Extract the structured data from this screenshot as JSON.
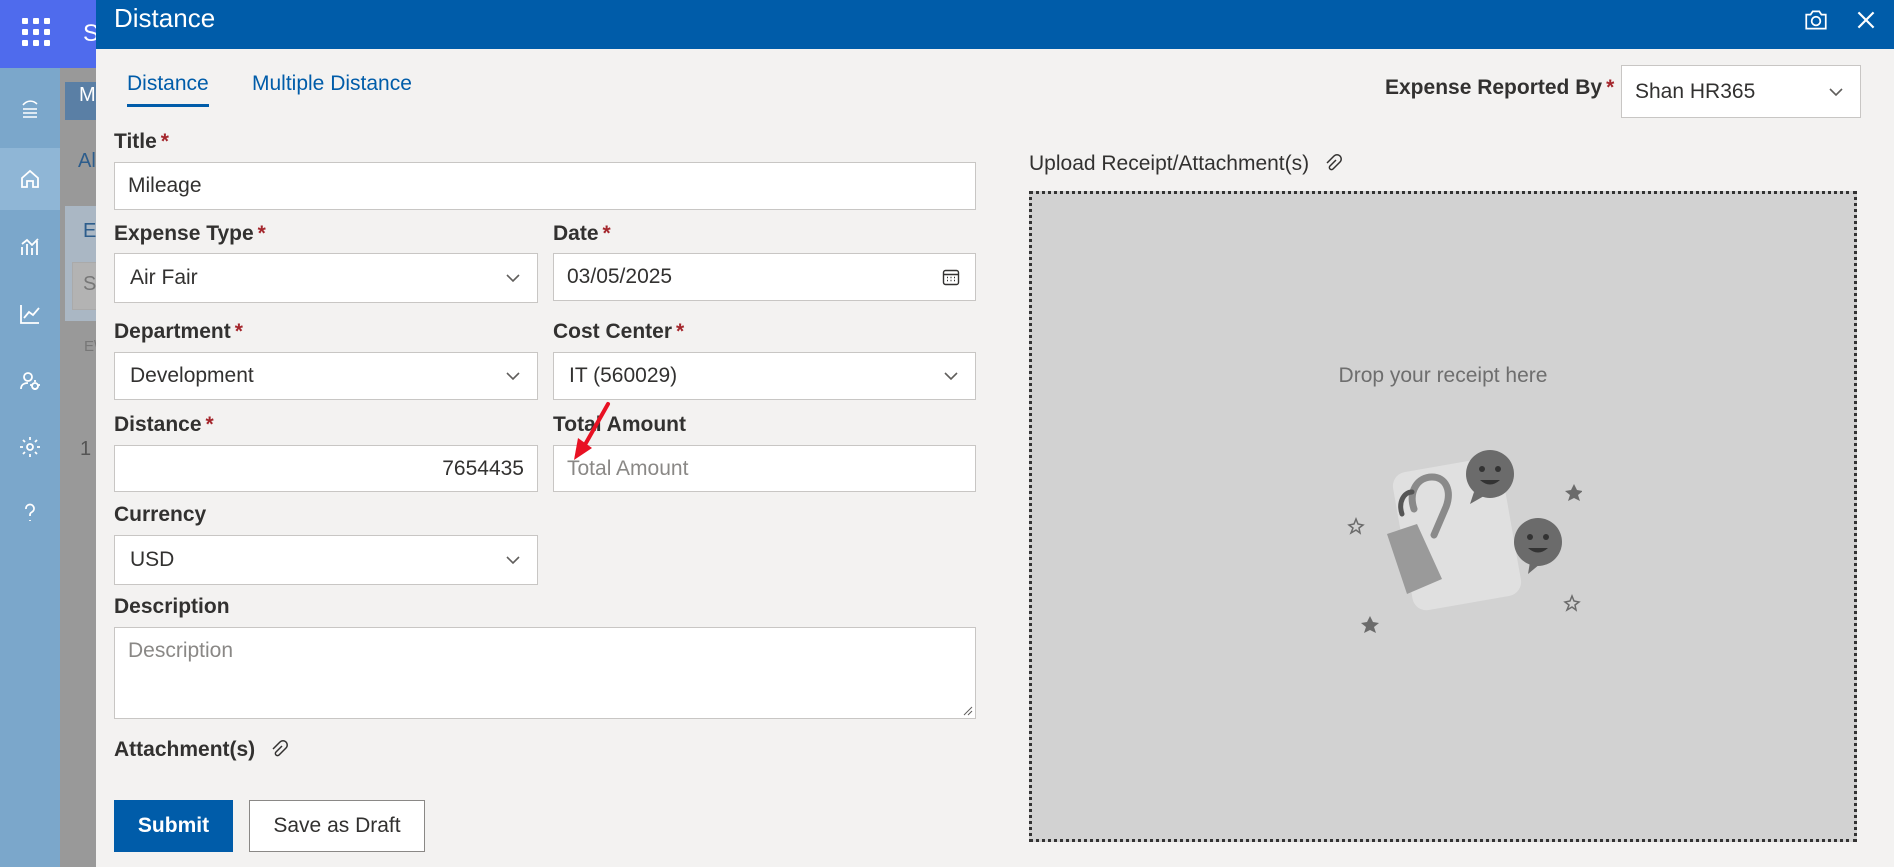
{
  "background": {
    "brand_letter": "S",
    "tab_letter": "M",
    "tab_text": "Al",
    "section_letter": "E",
    "search_letter": "S",
    "column_text": "E\\",
    "row_number": "1"
  },
  "panel": {
    "title": "Distance",
    "tabs": [
      {
        "label": "Distance",
        "active": true
      },
      {
        "label": "Multiple Distance",
        "active": false
      }
    ]
  },
  "form": {
    "reported_by": {
      "label": "Expense Reported By",
      "required": "*",
      "value": "Shan HR365"
    },
    "title": {
      "label": "Title",
      "required": "*",
      "value": "Mileage"
    },
    "expense_type": {
      "label": "Expense Type",
      "required": "*",
      "value": "Air Fair"
    },
    "date": {
      "label": "Date",
      "required": "*",
      "value": "03/05/2025"
    },
    "department": {
      "label": "Department",
      "required": "*",
      "value": "Development"
    },
    "cost_center": {
      "label": "Cost Center",
      "required": "*",
      "value": "IT (560029)"
    },
    "distance": {
      "label": "Distance",
      "required": "*",
      "value": "7654435"
    },
    "total_amount": {
      "label": "Total Amount",
      "placeholder": "Total Amount"
    },
    "currency": {
      "label": "Currency",
      "value": "USD"
    },
    "description": {
      "label": "Description",
      "placeholder": "Description"
    },
    "attachments": {
      "label": "Attachment(s)"
    },
    "submit_label": "Submit",
    "draft_label": "Save as Draft"
  },
  "upload": {
    "label": "Upload Receipt/Attachment(s)",
    "drop_text": "Drop your receipt here"
  },
  "colors": {
    "header": "#005ca9",
    "primary_button": "#005ca9",
    "required": "#a4262c",
    "annotation_arrow": "#e81123"
  },
  "icons": [
    "waffle-icon",
    "home-icon",
    "chart-icon",
    "trend-icon",
    "user-settings-icon",
    "gear-icon",
    "help-icon",
    "camera-icon",
    "close-icon",
    "calendar-icon",
    "chevron-down-icon",
    "paperclip-icon"
  ]
}
